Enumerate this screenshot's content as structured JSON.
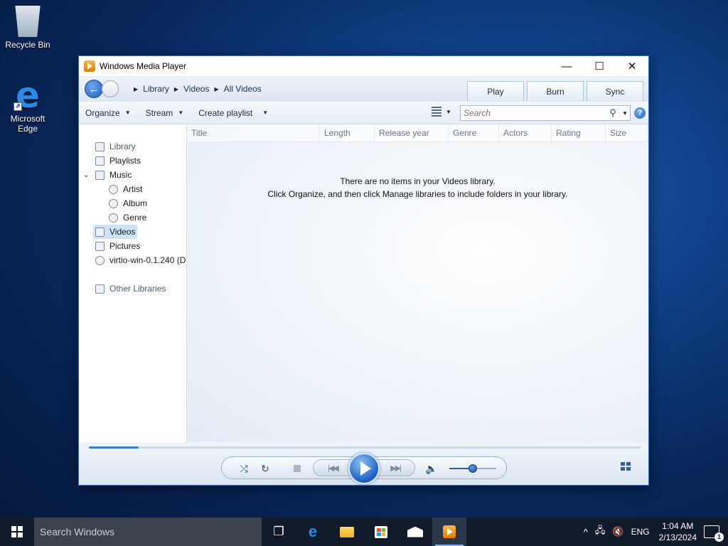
{
  "desktop": {
    "icons": [
      {
        "label": "Recycle Bin"
      },
      {
        "label": "Microsoft Edge"
      }
    ]
  },
  "window": {
    "title": "Windows Media Player",
    "controls": {
      "minimize": "—",
      "maximize": "☐",
      "close": "✕"
    }
  },
  "nav": {
    "breadcrumb": [
      "Library",
      "Videos",
      "All Videos"
    ],
    "tabs": [
      "Play",
      "Burn",
      "Sync"
    ]
  },
  "toolbar": {
    "organize": "Organize",
    "stream": "Stream",
    "create_playlist": "Create playlist",
    "search_placeholder": "Search"
  },
  "sidebar": {
    "items": [
      {
        "label": "Library"
      },
      {
        "label": "Playlists"
      },
      {
        "label": "Music"
      },
      {
        "label": "Artist"
      },
      {
        "label": "Album"
      },
      {
        "label": "Genre"
      },
      {
        "label": "Videos"
      },
      {
        "label": "Pictures"
      },
      {
        "label": "virtio-win-0.1.240 (D"
      },
      {
        "label": "Other Libraries"
      }
    ],
    "selected": "Videos"
  },
  "columns": [
    "Title",
    "Length",
    "Release year",
    "Genre",
    "Actors",
    "Rating",
    "Size"
  ],
  "empty": {
    "line1": "There are no items in your Videos library.",
    "line2": "Click Organize, and then click Manage libraries to include folders in your library."
  },
  "player": {
    "seek_progress": 0.09,
    "volume_level": 0.5
  },
  "taskbar": {
    "search_placeholder": "Search Windows",
    "language": "ENG",
    "time": "1:04 AM",
    "date": "2/13/2024",
    "notification_count": "1"
  },
  "colors": {
    "accent": "#1f5fbf",
    "selection": "#cde3f8",
    "taskbar": "#101a2a"
  }
}
